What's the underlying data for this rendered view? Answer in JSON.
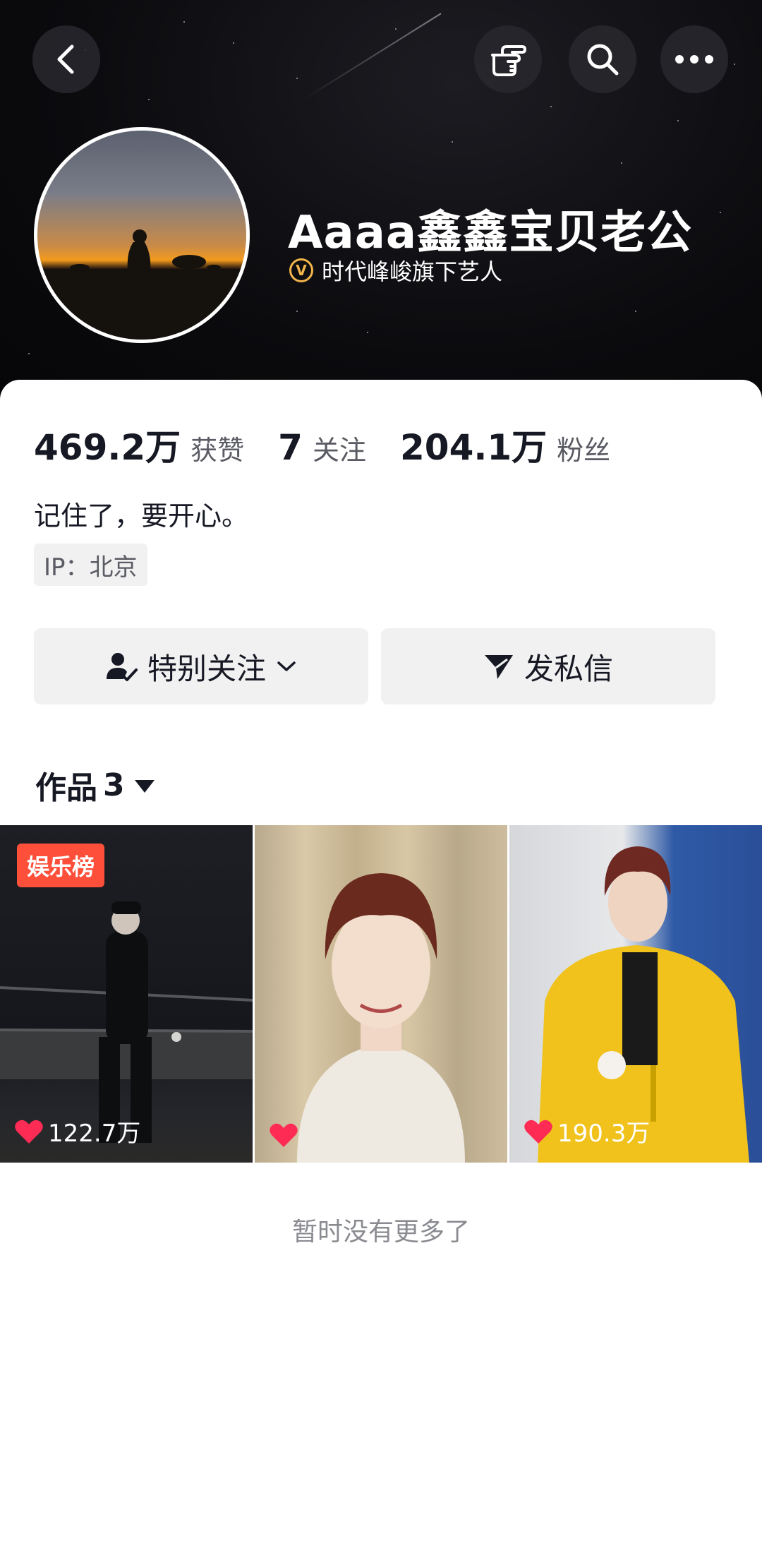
{
  "profile": {
    "nickname": "Aaaa鑫鑫宝贝老公",
    "verified_text": "时代峰峻旗下艺人",
    "verified_badge": "V"
  },
  "stats": {
    "likes_value": "469.2万",
    "likes_label": "获赞",
    "following_value": "7",
    "following_label": "关注",
    "followers_value": "204.1万",
    "followers_label": "粉丝"
  },
  "bio": "记住了，要开心。",
  "ip_location": "IP：北京",
  "actions": {
    "special_follow_label": "特别关注",
    "message_label": "发私信"
  },
  "works": {
    "label": "作品",
    "count": "3"
  },
  "videos": [
    {
      "badge": "娱乐榜",
      "likes": "122.7万"
    },
    {
      "badge": "",
      "likes": ""
    },
    {
      "badge": "",
      "likes": "190.3万"
    }
  ],
  "end_note": "暂时没有更多了",
  "colors": {
    "accent_red": "#fe2c55",
    "badge_orange": "#fe4f3a",
    "verified_gold": "#f2b54a"
  },
  "icons": {
    "back": "chevron-left-icon",
    "gesture": "pointing-hand-icon",
    "search": "search-icon",
    "more": "more-icon",
    "heart": "heart-icon"
  }
}
